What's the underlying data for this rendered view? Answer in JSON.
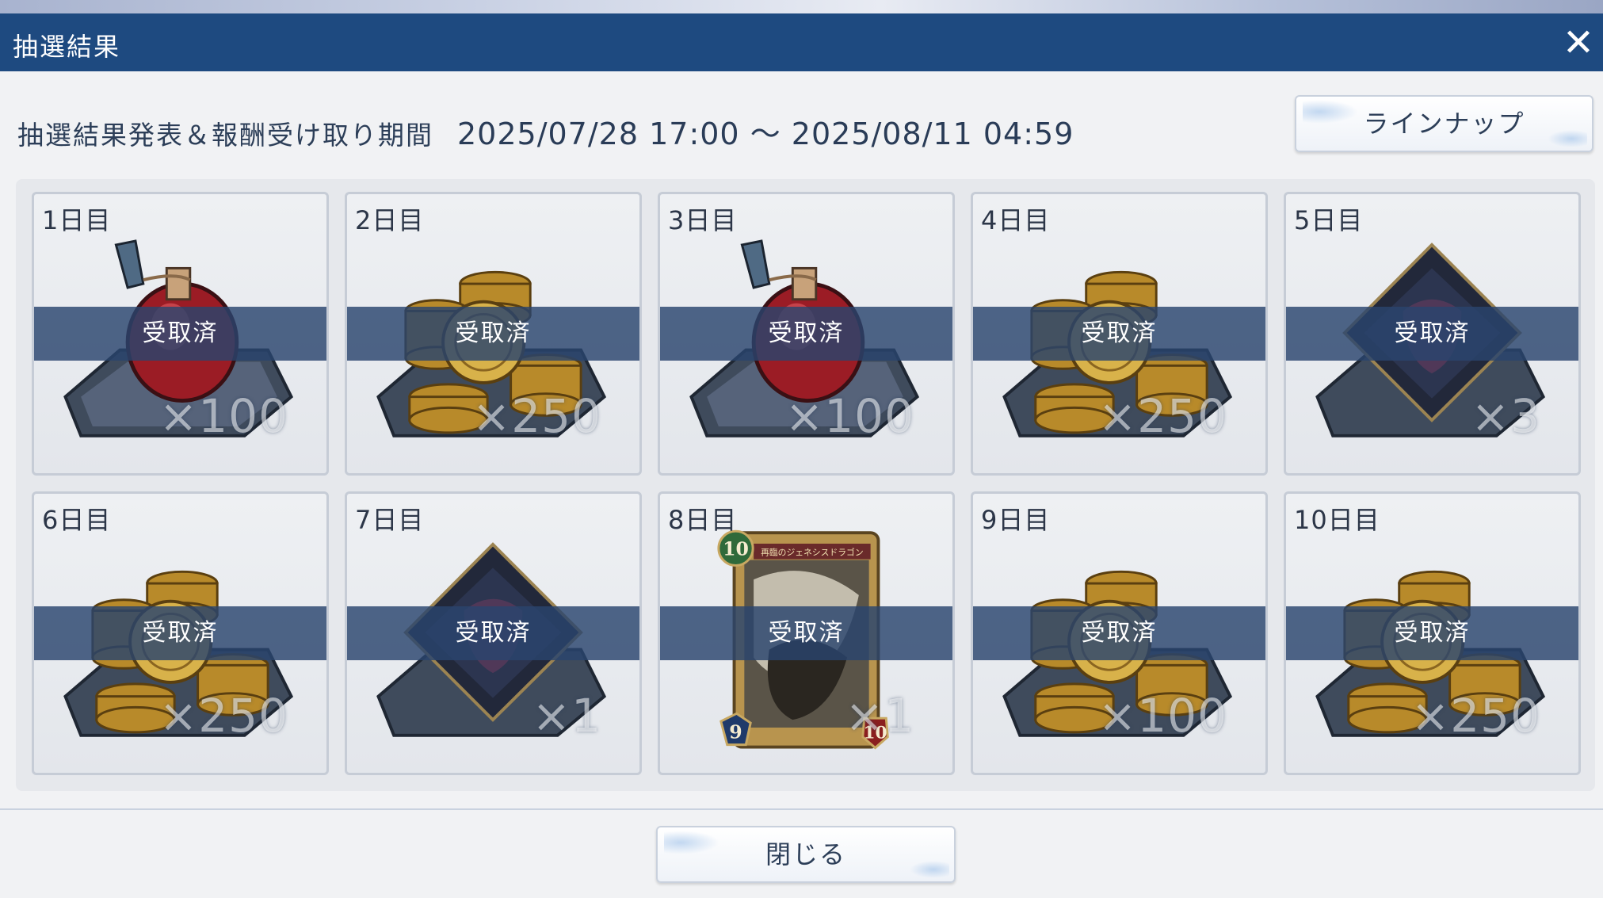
{
  "window": {
    "title": "抽選結果"
  },
  "period": {
    "label": "抽選結果発表＆報酬受け取り期間",
    "dates": "2025/07/28 17:00 ～ 2025/08/11 04:59"
  },
  "buttons": {
    "lineup_label": "ラインナップ",
    "close_label": "閉じる"
  },
  "cards": [
    {
      "day": "1日目",
      "item_icon": "potion-icon",
      "status": "受取済",
      "qty": "×100"
    },
    {
      "day": "2日目",
      "item_icon": "coins-icon",
      "status": "受取済",
      "qty": "×250"
    },
    {
      "day": "3日目",
      "item_icon": "potion-icon",
      "status": "受取済",
      "qty": "×100"
    },
    {
      "day": "4日目",
      "item_icon": "coins-icon",
      "status": "受取済",
      "qty": "×250"
    },
    {
      "day": "5日目",
      "item_icon": "diamond-emblem-icon",
      "status": "受取済",
      "qty": "×3"
    },
    {
      "day": "6日目",
      "item_icon": "coins-icon",
      "status": "受取済",
      "qty": "×250"
    },
    {
      "day": "7日目",
      "item_icon": "diamond-emblem-icon",
      "status": "受取済",
      "qty": "×1"
    },
    {
      "day": "8日目",
      "item_icon": "dragon-card-icon",
      "status": "受取済",
      "qty": "×1",
      "card": {
        "cost": "10",
        "name": "再臨のジェネシスドラゴン",
        "attack": "9",
        "defense": "10"
      }
    },
    {
      "day": "9日目",
      "item_icon": "coins-icon",
      "status": "受取済",
      "qty": "×100"
    },
    {
      "day": "10日目",
      "item_icon": "coins-icon",
      "status": "受取済",
      "qty": "×250"
    }
  ],
  "colors": {
    "title_bar": "#1e4a80",
    "banner": "#2a446e",
    "card_bg": "#e3e6eb"
  }
}
